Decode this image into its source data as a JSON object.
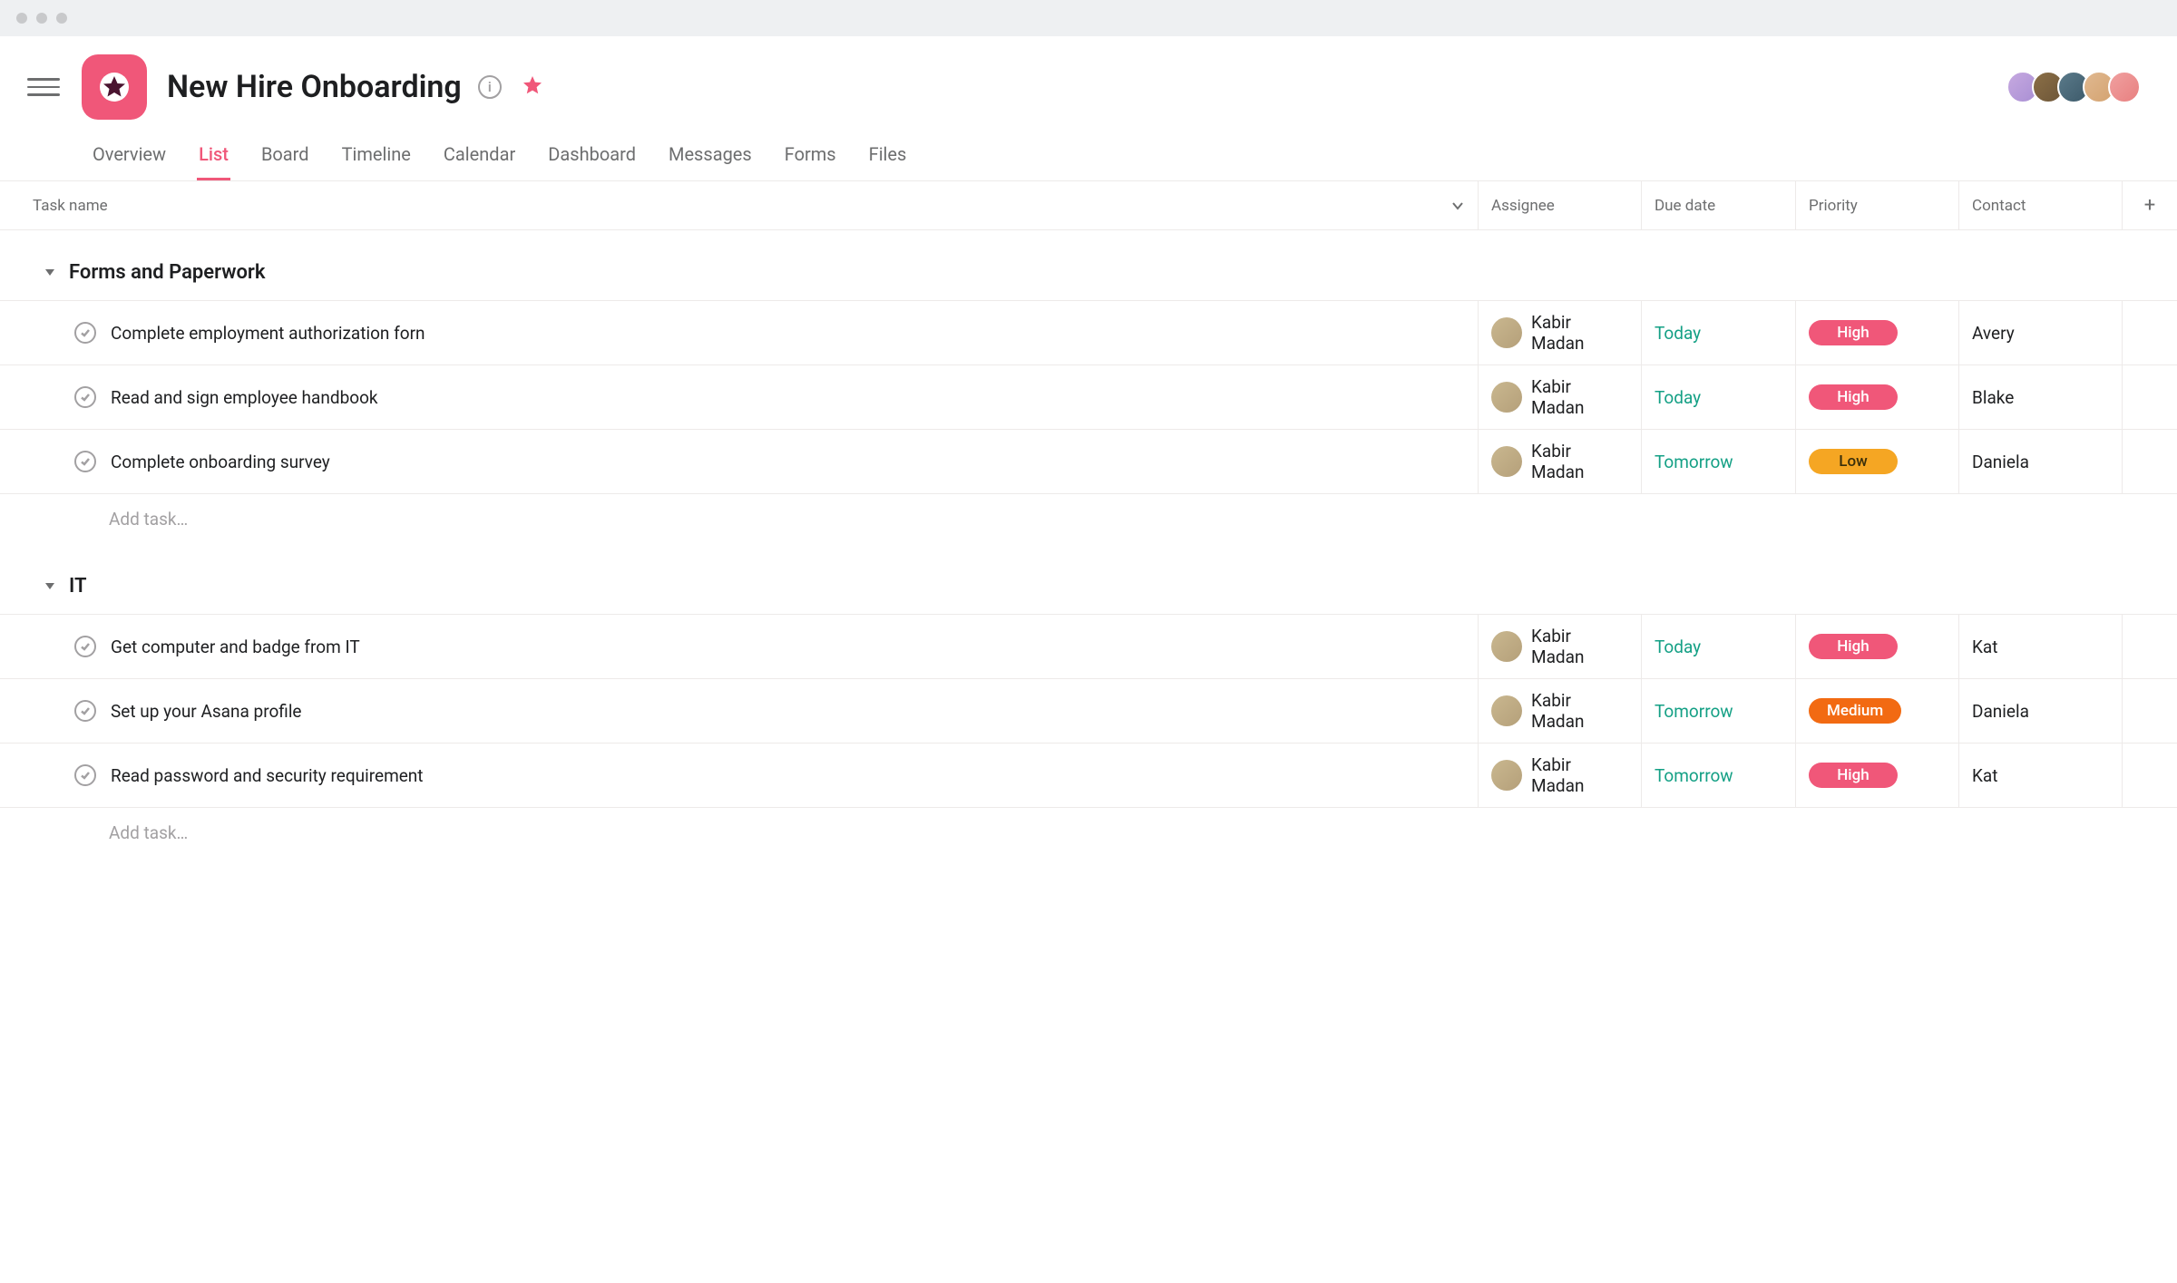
{
  "project": {
    "title": "New Hire Onboarding"
  },
  "tabs": [
    {
      "label": "Overview",
      "active": false
    },
    {
      "label": "List",
      "active": true
    },
    {
      "label": "Board",
      "active": false
    },
    {
      "label": "Timeline",
      "active": false
    },
    {
      "label": "Calendar",
      "active": false
    },
    {
      "label": "Dashboard",
      "active": false
    },
    {
      "label": "Messages",
      "active": false
    },
    {
      "label": "Forms",
      "active": false
    },
    {
      "label": "Files",
      "active": false
    }
  ],
  "columns": {
    "task_name": "Task name",
    "assignee": "Assignee",
    "due_date": "Due date",
    "priority": "Priority",
    "contact": "Contact"
  },
  "add_task_label": "Add task…",
  "sections": [
    {
      "title": "Forms and Paperwork",
      "tasks": [
        {
          "name": "Complete employment authorization forn",
          "assignee": "Kabir Madan",
          "due": "Today",
          "priority": "High",
          "contact": "Avery"
        },
        {
          "name": "Read and sign employee handbook",
          "assignee": "Kabir Madan",
          "due": "Today",
          "priority": "High",
          "contact": "Blake"
        },
        {
          "name": "Complete onboarding survey",
          "assignee": "Kabir Madan",
          "due": "Tomorrow",
          "priority": "Low",
          "contact": "Daniela"
        }
      ]
    },
    {
      "title": "IT",
      "tasks": [
        {
          "name": "Get computer and badge from IT",
          "assignee": "Kabir Madan",
          "due": "Today",
          "priority": "High",
          "contact": "Kat"
        },
        {
          "name": "Set up your Asana profile",
          "assignee": "Kabir Madan",
          "due": "Tomorrow",
          "priority": "Medium",
          "contact": "Daniela"
        },
        {
          "name": "Read password and security requirement",
          "assignee": "Kabir Madan",
          "due": "Tomorrow",
          "priority": "High",
          "contact": "Kat"
        }
      ]
    }
  ]
}
